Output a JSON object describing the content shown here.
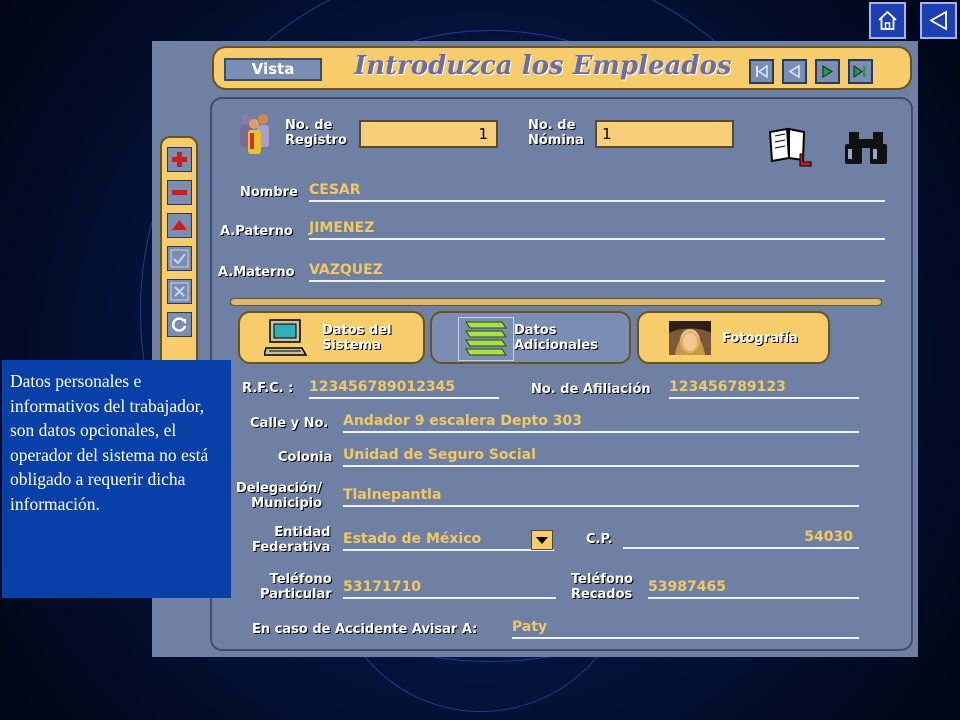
{
  "nav": {
    "home_icon": "home-icon",
    "back_icon": "back-triangle-icon"
  },
  "header": {
    "vista": "Vista",
    "title": "Introduzca los Empleados"
  },
  "record": {
    "registro_label_1": "No. de",
    "registro_label_2": "Registro",
    "registro_value": "1",
    "nomina_label_1": "No. de",
    "nomina_label_2": "Nómina",
    "nomina_value": "1"
  },
  "person": {
    "nombre_label": "Nombre",
    "nombre_value": "CESAR",
    "paterno_label": "A.Paterno",
    "paterno_value": "JIMENEZ",
    "materno_label": "A.Materno",
    "materno_value": "VAZQUEZ"
  },
  "tabs": {
    "sistema_1": "Datos del",
    "sistema_2": "Sistema",
    "adicionales_1": "Datos",
    "adicionales_2": "Adicionales",
    "foto": "Fotografía"
  },
  "details": {
    "rfc_label": "R.F.C. :",
    "rfc_value": "123456789012345",
    "afiliacion_label": "No. de Afiliación",
    "afiliacion_value": "123456789123",
    "calle_label": "Calle y No.",
    "calle_value": "Andador 9 escalera Depto 303",
    "colonia_label": "Colonia",
    "colonia_value": "Unidad de Seguro Social",
    "delegacion_label_1": "Delegación/",
    "delegacion_label_2": "Municipio",
    "delegacion_value": "Tlalnepantla",
    "entidad_label_1": "Entidad",
    "entidad_label_2": "Federativa",
    "entidad_value": "Estado de México",
    "cp_label": "C.P.",
    "cp_value": "54030",
    "tel_part_label_1": "Teléfono",
    "tel_part_label_2": "Particular",
    "tel_part_value": "53171710",
    "tel_rec_label_1": "Teléfono",
    "tel_rec_label_2": "Recados",
    "tel_rec_value": "53987465",
    "accidente_label": "En caso de Accidente Avisar A:",
    "accidente_value": "Paty"
  },
  "note": "Datos personales e informativos del trabajador, son datos opcionales, el operador del sistema no está obligado a requerir dicha información."
}
